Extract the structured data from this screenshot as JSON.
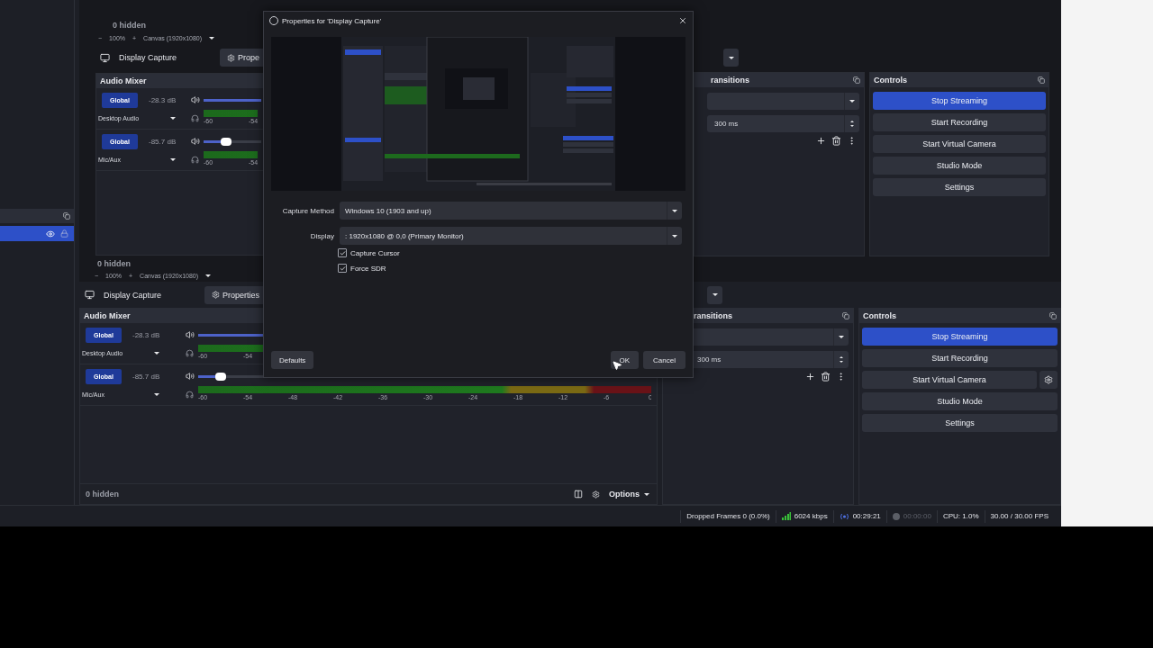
{
  "dialog": {
    "title": "Properties for 'Display Capture'",
    "fields": [
      {
        "label": "Capture Method",
        "value": "Windows 10 (1903 and up)"
      },
      {
        "label": "Display",
        "value": ": 1920x1080 @ 0,0 (Primary Monitor)"
      }
    ],
    "checkboxes": [
      {
        "label": "Capture Cursor",
        "checked": true
      },
      {
        "label": "Force SDR",
        "checked": true
      }
    ],
    "defaults_button": "Defaults",
    "ok_button": "OK",
    "cancel_button": "Cancel"
  },
  "sources_dock": {
    "items": [
      {
        "selected": true
      }
    ]
  },
  "capture": {
    "hidden_top": "0 hidden",
    "zoom_top": {
      "minus": "−",
      "zoom": "100%",
      "plus": "+",
      "canvas": "Canvas (1920x1080)"
    },
    "source_toolbar": {
      "source": "Display Capture",
      "properties": "Prope"
    },
    "audio_mixer": {
      "title": "Audio Mixer",
      "channels": [
        {
          "badge": "Global",
          "reading": "-28.3 dB",
          "name": "Desktop Audio",
          "level": 0.6,
          "ticks": [
            "-60",
            "-54"
          ]
        },
        {
          "badge": "Global",
          "reading": "-85.7 dB",
          "name": "Mic/Aux",
          "level": 0.05,
          "ticks": [
            "-60",
            "-54"
          ]
        }
      ]
    },
    "hidden_bottom": "0 hidden",
    "zoom_bottom": {
      "minus": "−",
      "zoom": "100%",
      "plus": "+",
      "canvas": "Canvas (1920x1080)"
    },
    "transitions": {
      "title": "ransitions",
      "duration": "300 ms"
    },
    "controls": {
      "title": "Controls",
      "buttons": [
        {
          "label": "Stop Streaming",
          "active": true,
          "has_settings": false
        },
        {
          "label": "Start Recording",
          "active": false,
          "has_settings": false
        },
        {
          "label": "Start Virtual Camera",
          "active": false,
          "has_settings": false
        },
        {
          "label": "Studio Mode",
          "active": false,
          "has_settings": false
        },
        {
          "label": "Settings",
          "active": false,
          "has_settings": false
        }
      ]
    }
  },
  "outer": {
    "source_toolbar": {
      "source": "Display Capture",
      "properties": "Properties"
    },
    "audio_mixer": {
      "title": "Audio Mixer",
      "channels": [
        {
          "badge": "Global",
          "reading": "-28.3 dB",
          "name": "Desktop Audio",
          "level": 0.6,
          "ticks": [
            "-60",
            "-54"
          ]
        },
        {
          "badge": "Global",
          "reading": "-85.7 dB",
          "name": "Mic/Aux",
          "level": 0.05,
          "ticks": [
            "-60",
            "-54",
            "-48",
            "-42",
            "-36",
            "-30",
            "-24",
            "-18",
            "-12",
            "-6",
            "0"
          ]
        }
      ]
    },
    "mixer_footer": {
      "hidden": "0 hidden",
      "options": "Options"
    },
    "transitions": {
      "title": "ransitions",
      "duration": "300 ms"
    },
    "controls": {
      "title": "Controls",
      "buttons": [
        {
          "label": "Stop Streaming",
          "active": true,
          "has_settings": false
        },
        {
          "label": "Start Recording",
          "active": false,
          "has_settings": false
        },
        {
          "label": "Start Virtual Camera",
          "active": false,
          "has_settings": true
        },
        {
          "label": "Studio Mode",
          "active": false,
          "has_settings": false
        },
        {
          "label": "Settings",
          "active": false,
          "has_settings": false
        }
      ]
    }
  },
  "status_bar": [
    {
      "kind": "dropped",
      "text": "Dropped Frames 0 (0.0%)"
    },
    {
      "kind": "network",
      "text": "6024 kbps"
    },
    {
      "kind": "stream",
      "text": "00:29:21"
    },
    {
      "kind": "record",
      "text": "00:00:00"
    },
    {
      "kind": "text",
      "text": "CPU: 1.0%"
    },
    {
      "kind": "text",
      "text": "30.00 / 30.00 FPS"
    }
  ]
}
